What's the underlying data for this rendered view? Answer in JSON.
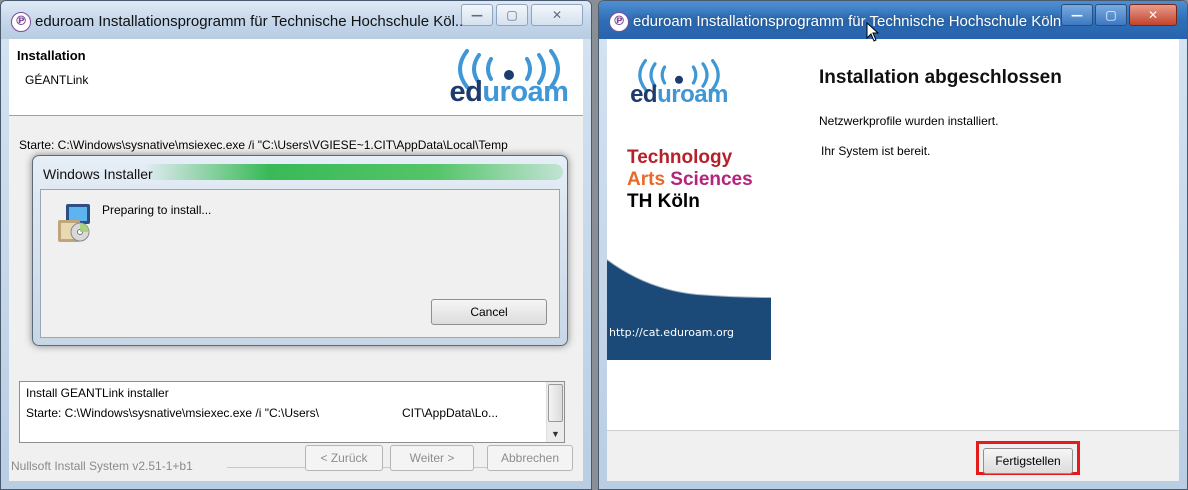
{
  "left_window": {
    "title": "eduroam Installationsprogramm für Technische Hochschule Köl...",
    "controls": [
      "minimize",
      "maximize",
      "close"
    ],
    "header": {
      "title": "Installation",
      "subtitle": "GÉANTLink"
    },
    "logo": "eduroam",
    "status_line": "Starte: C:\\Windows\\sysnative\\msiexec.exe /i \"C:\\Users\\VGIESE~1.CIT\\AppData\\Local\\Temp",
    "log": [
      "Install GEANTLink installer",
      "Starte: C:\\Windows\\sysnative\\msiexec.exe /i \"C:\\Users\\",
      "CIT\\AppData\\Lo..."
    ],
    "branding": "Nullsoft Install System v2.51-1+b1",
    "buttons": {
      "back": "< Zurück",
      "next": "Weiter >",
      "cancel": "Abbrechen"
    }
  },
  "installer_dialog": {
    "title": "Windows Installer",
    "message": "Preparing to install...",
    "cancel_label": "Cancel"
  },
  "right_window": {
    "title": "eduroam Installationsprogramm für Technische Hochschule Köln",
    "logo": "eduroam",
    "brand": {
      "line1": "Technology",
      "line2a": "Arts ",
      "line2b": "Sciences",
      "line3": "TH Köln"
    },
    "url": "http://cat.eduroam.org",
    "heading": "Installation abgeschlossen",
    "text1": "Netzwerkprofile wurden installiert.",
    "text2": "Ihr System ist bereit.",
    "finish_label": "Fertigstellen"
  },
  "colors": {
    "eduroam_dark": "#1d3b6d",
    "eduroam_light": "#3f97d6",
    "sidebar_band": "#1c4a78",
    "highlight": "#e31b1b"
  }
}
